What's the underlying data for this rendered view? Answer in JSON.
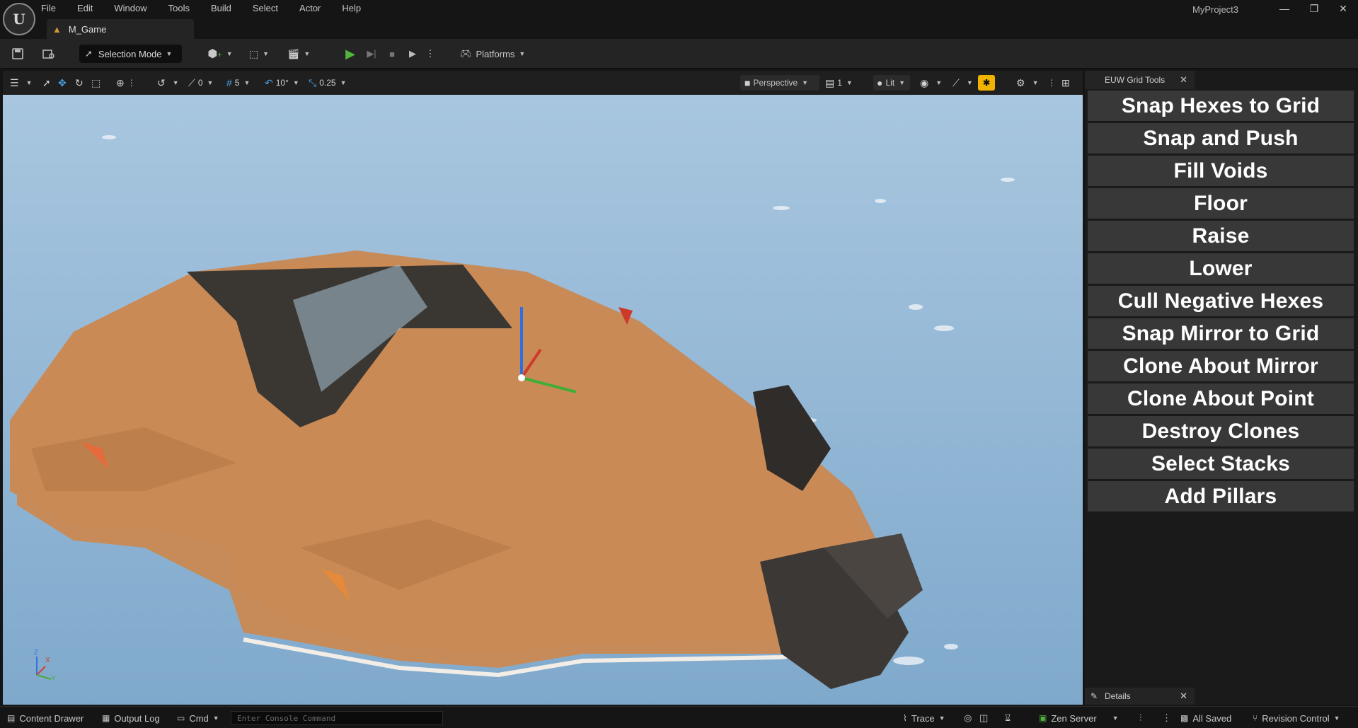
{
  "app": {
    "project_name": "MyProject3",
    "logo_icon": "unreal-logo-icon"
  },
  "menu": [
    "File",
    "Edit",
    "Window",
    "Tools",
    "Build",
    "Select",
    "Actor",
    "Help"
  ],
  "level_tab": {
    "label": "M_Game",
    "icon": "level-icon"
  },
  "toolbar": {
    "selection_mode_label": "Selection Mode",
    "platforms_label": "Platforms"
  },
  "viewport_toolbar": {
    "rotation_snap_value": "0",
    "grid_snap_value": "5",
    "angle_snap_value": "10°",
    "scale_snap_value": "0.25",
    "perspective_label": "Perspective",
    "camera_speed_value": "1",
    "lit_label": "Lit"
  },
  "axis_gizmo": {
    "z": "Z",
    "x": "X",
    "y": "Y"
  },
  "euw_panel": {
    "tab_label": "EUW Grid Tools",
    "buttons": [
      "Snap Hexes to Grid",
      "Snap and Push",
      "Fill Voids",
      "Floor",
      "Raise",
      "Lower",
      "Cull Negative Hexes",
      "Snap Mirror to Grid",
      "Clone About Mirror",
      "Clone About Point",
      "Destroy Clones",
      "Select Stacks",
      "Add Pillars"
    ]
  },
  "details_tab": {
    "label": "Details"
  },
  "statusbar": {
    "content_drawer_label": "Content Drawer",
    "output_log_label": "Output Log",
    "cmd_label": "Cmd",
    "console_placeholder": "Enter Console Command",
    "trace_label": "Trace",
    "zen_server_label": "Zen Server",
    "all_saved_label": "All Saved",
    "revision_control_label": "Revision Control"
  },
  "colors": {
    "background": "#151515",
    "panel": "#242424",
    "tool_button": "#383838",
    "play_green": "#4fb53c",
    "snap_active": "#f0b400",
    "terrain": "#c98a55",
    "water": "#8fb6d4"
  }
}
